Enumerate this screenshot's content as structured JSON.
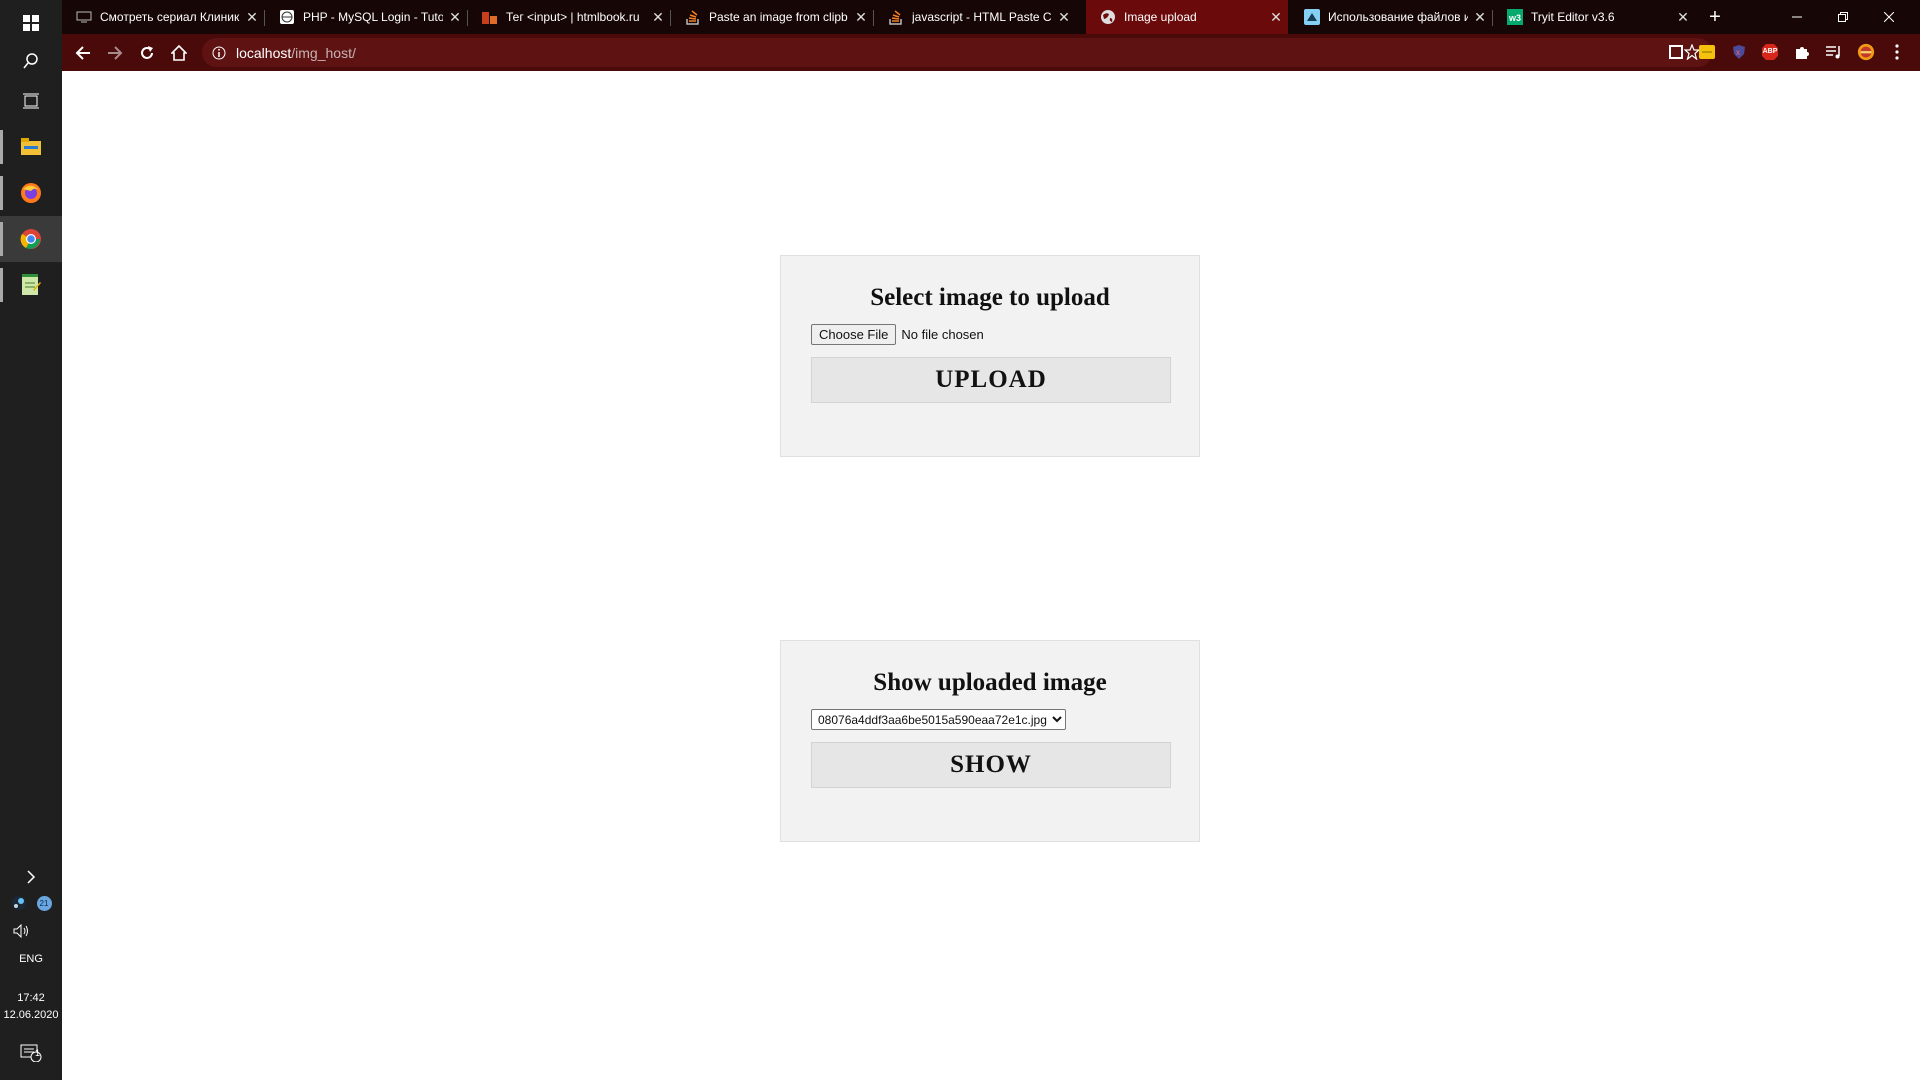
{
  "taskbar": {
    "language": "ENG",
    "time": "17:42",
    "date": "12.06.2020",
    "notification_count": "1",
    "tray_badge": "21"
  },
  "tabs": [
    {
      "title": "Смотреть сериал Клиника",
      "icon": "monitor-icon",
      "active": false
    },
    {
      "title": "PHP - MySQL Login - Tuto",
      "icon": "globe-icon",
      "active": false
    },
    {
      "title": "Тег <input> | htmlbook.ru",
      "icon": "htmlbook-icon",
      "active": false
    },
    {
      "title": "Paste an image from clipb",
      "icon": "stackoverflow-icon",
      "active": false
    },
    {
      "title": "javascript - HTML Paste Cl",
      "icon": "stackoverflow-icon",
      "active": false
    },
    {
      "title": "Image upload",
      "icon": "globe-icon",
      "active": true
    },
    {
      "title": "Использование файлов и",
      "icon": "mdn-icon",
      "active": false
    },
    {
      "title": "Tryit Editor v3.6",
      "icon": "w3schools-icon",
      "active": false
    }
  ],
  "address_bar": {
    "host": "localhost",
    "path": "/img_host/"
  },
  "extensions": {
    "abp_label": "ABP"
  },
  "upload_form": {
    "heading": "Select image to upload",
    "file_button": "Choose File",
    "file_status": "No file chosen",
    "submit_label": "UPLOAD"
  },
  "show_form": {
    "heading": "Show uploaded image",
    "selected_file": "08076a4ddf3aa6be5015a590eaa72e1c.jpg",
    "submit_label": "SHOW"
  },
  "colors": {
    "tabstrip": "#170606",
    "active_tab": "#6b0a0a",
    "toolbar": "#4a0a0a",
    "omnibox": "#5e1212",
    "card_bg": "#f2f2f2"
  }
}
